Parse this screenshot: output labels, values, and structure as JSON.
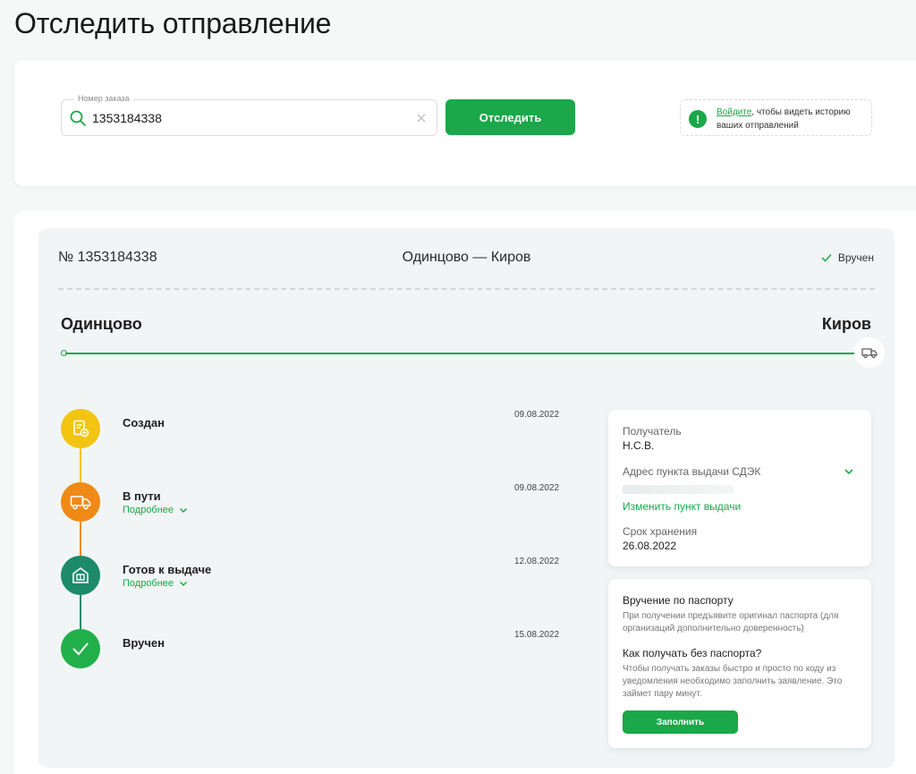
{
  "page": {
    "title": "Отследить отправление"
  },
  "search": {
    "legend": "Номер заказа",
    "value": "1353184338",
    "button_label": "Отследить",
    "hint_link": "Войдите",
    "hint_text": ", чтобы видеть историю ваших отправлений"
  },
  "order": {
    "number": "№ 1353184338",
    "route": "Одинцово — Киров",
    "status": "Вручен",
    "city_from": "Одинцово",
    "city_to": "Киров"
  },
  "timeline": [
    {
      "title": "Создан",
      "date": "09.08.2022",
      "more": "",
      "color": "#f2c511",
      "icon": "document-plus-icon"
    },
    {
      "title": "В пути",
      "date": "09.08.2022",
      "more": "Подробнее",
      "color": "#ef8a17",
      "icon": "truck-icon"
    },
    {
      "title": "Готов к выдаче",
      "date": "12.08.2022",
      "more": "Подробнее",
      "color": "#1d8a6a",
      "icon": "pickup-point-icon"
    },
    {
      "title": "Вручен",
      "date": "15.08.2022",
      "more": "",
      "color": "#22b04b",
      "icon": "check-icon"
    }
  ],
  "recipient": {
    "recipient_label": "Получатель",
    "recipient_value": "Н.С.В.",
    "address_label": "Адрес пункта выдачи СДЭК",
    "change_link": "Изменить пункт выдачи",
    "storage_label": "Срок хранения",
    "storage_value": "26.08.2022"
  },
  "passport": {
    "title": "Вручение по паспорту",
    "text": "При получении предъявите оригинал паспорта (для организаций дополнительно доверенность)",
    "question": "Как получать без паспорта?",
    "question_text": "Чтобы получать заказы быстро и просто по коду из уведомления необходимо заполнить заявление. Это займет пару минут.",
    "button_label": "Заполнить"
  },
  "colors": {
    "accent": "#1aa84a"
  }
}
